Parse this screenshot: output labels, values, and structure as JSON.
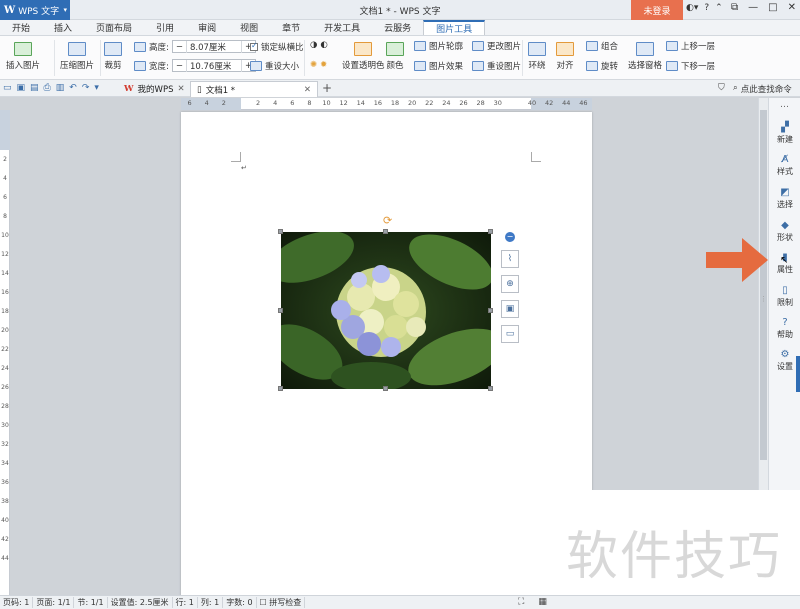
{
  "titlebar": {
    "app_label": "WPS 文字",
    "window_title": "文档1 * - WPS 文字",
    "login_label": "未登录",
    "help_label": "?",
    "controls": [
      "—",
      "□",
      "✕"
    ]
  },
  "menu_tabs": [
    "开始",
    "插入",
    "页面布局",
    "引用",
    "审阅",
    "视图",
    "章节",
    "开发工具",
    "云服务",
    "图片工具"
  ],
  "ribbon": {
    "insert_picture": "插入图片",
    "compress_picture": "压缩图片",
    "crop": "裁剪",
    "height_label": "高度:",
    "height_value": "8.07厘米",
    "width_label": "宽度:",
    "width_value": "10.76厘米",
    "lock_ratio": "锁定纵横比",
    "reset_size": "重设大小",
    "set_transparent": "设置透明色",
    "color": "颜色",
    "picture_outline": "图片轮廓",
    "picture_effect": "图片效果",
    "change_picture": "更改图片",
    "reset_picture": "重设图片",
    "wrap": "环绕",
    "align": "对齐",
    "group": "组合",
    "rotate": "旋转",
    "selection_pane": "选择窗格",
    "bring_forward": "上移一层",
    "send_backward": "下移一层"
  },
  "doctabs": {
    "my_wps": "我的WPS",
    "doc_name": "文档1 *",
    "find_command": "点此查找命令"
  },
  "ruler_ticks": [
    "6",
    "4",
    "2",
    "",
    "2",
    "4",
    "6",
    "8",
    "10",
    "12",
    "14",
    "16",
    "18",
    "20",
    "22",
    "24",
    "26",
    "28",
    "30",
    "",
    "40",
    "42",
    "44",
    "46"
  ],
  "vruler_ticks": [
    "2",
    "4",
    "6",
    "8",
    "10",
    "12",
    "14",
    "16",
    "18",
    "20",
    "22",
    "24",
    "26",
    "28",
    "30",
    "32",
    "34",
    "36",
    "38",
    "40",
    "42",
    "44"
  ],
  "side_panel": [
    {
      "label": "新建",
      "icon": "new-icon"
    },
    {
      "label": "样式",
      "icon": "style-icon"
    },
    {
      "label": "选择",
      "icon": "select-icon"
    },
    {
      "label": "形状",
      "icon": "shape-icon"
    },
    {
      "label": "属性",
      "icon": "property-icon"
    },
    {
      "label": "限制",
      "icon": "restrict-icon"
    },
    {
      "label": "帮助",
      "icon": "help-icon"
    },
    {
      "label": "设置",
      "icon": "settings-icon"
    }
  ],
  "status": {
    "page_num": "页码: 1",
    "pages": "页面: 1/1",
    "section": "节: 1/1",
    "setting": "设置值: 2.5厘米",
    "row": "行: 1",
    "col": "列: 1",
    "words": "字数: 0",
    "spell": "拼写检查"
  },
  "watermark_text": "软件技巧",
  "colors": {
    "accent": "#2f6db5",
    "login": "#e8704e",
    "arrow": "#e56b3f"
  }
}
